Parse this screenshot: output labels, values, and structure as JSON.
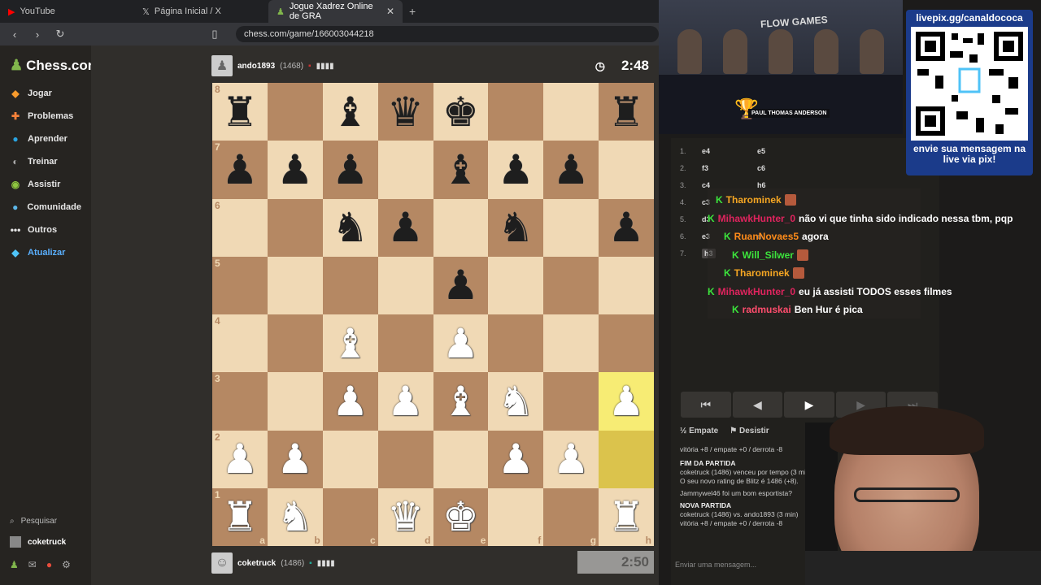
{
  "browser": {
    "tabs": [
      {
        "title": "YouTube",
        "icon": "youtube-icon"
      },
      {
        "title": "Página Inicial / X",
        "icon": "x-icon"
      },
      {
        "title": "Jogue Xadrez Online de GRA",
        "icon": "chess-icon",
        "active": true
      }
    ],
    "url": "chess.com/game/166003044218"
  },
  "sidebar": {
    "logo": "Chess.com",
    "items": [
      {
        "label": "Jogar",
        "icon": "play-icon"
      },
      {
        "label": "Problemas",
        "icon": "puzzle-icon"
      },
      {
        "label": "Aprender",
        "icon": "learn-icon"
      },
      {
        "label": "Treinar",
        "icon": "train-icon"
      },
      {
        "label": "Assistir",
        "icon": "watch-icon"
      },
      {
        "label": "Comunidade",
        "icon": "community-icon"
      },
      {
        "label": "Outros",
        "icon": "more-icon"
      },
      {
        "label": "Atualizar",
        "icon": "diamond-icon"
      }
    ],
    "search_label": "Pesquisar",
    "user": "coketruck"
  },
  "game": {
    "top_player": {
      "name": "ando1893",
      "rating": "(1468)"
    },
    "bottom_player": {
      "name": "coketruck",
      "rating": "(1486)"
    },
    "top_clock": "2:48",
    "bottom_clock": "2:50",
    "ranks": [
      "8",
      "7",
      "6",
      "5",
      "4",
      "3",
      "2",
      "1"
    ],
    "files": [
      "a",
      "b",
      "c",
      "d",
      "e",
      "f",
      "g",
      "h"
    ],
    "board": [
      [
        "r",
        "",
        "b",
        "q",
        "k",
        "",
        "",
        "r"
      ],
      [
        "p",
        "p",
        "p",
        "",
        "b",
        "p",
        "p",
        ""
      ],
      [
        "",
        "",
        "n",
        "p",
        "",
        "n",
        "",
        "p"
      ],
      [
        "",
        "",
        "",
        "",
        "p",
        "",
        "",
        ""
      ],
      [
        "",
        "",
        "B",
        "",
        "P",
        "",
        "",
        ""
      ],
      [
        "",
        "",
        "P",
        "P",
        "B",
        "N",
        "",
        "P"
      ],
      [
        "P",
        "P",
        "",
        "",
        "",
        "P",
        "P",
        ""
      ],
      [
        "R",
        "N",
        "",
        "Q",
        "K",
        "",
        "",
        "R"
      ]
    ],
    "highlight_squares": [
      "h3",
      "h2"
    ]
  },
  "moves": [
    {
      "n": "1.",
      "w": "e4",
      "b": "e5"
    },
    {
      "n": "2.",
      "w": "f3",
      "b": "c6"
    },
    {
      "n": "3.",
      "w": "c4",
      "b": "h6"
    },
    {
      "n": "4.",
      "w": "c3",
      "b": ""
    },
    {
      "n": "5.",
      "w": "d3",
      "b": ""
    },
    {
      "n": "6.",
      "w": "e3",
      "b": "d"
    },
    {
      "n": "7.",
      "w": "h3",
      "b": ""
    }
  ],
  "stream_chat": [
    {
      "user": "Tharominek",
      "color": "#f5a623",
      "msg": ""
    },
    {
      "user": "MihawkHunter_0",
      "color": "#e0245e",
      "msg": "não vi que tinha sido indicado nessa tbm, pqp"
    },
    {
      "user": "RuanNovaes5",
      "color": "#ff8c1a",
      "msg": "agora"
    },
    {
      "user": "Will_Silwer",
      "color": "#3ce43c",
      "msg": ""
    },
    {
      "user": "Tharominek",
      "color": "#f5a623",
      "msg": ""
    },
    {
      "user": "MihawkHunter_0",
      "color": "#e0245e",
      "msg": "eu já assisti TODOS esses filmes"
    },
    {
      "user": "radmuskai",
      "color": "#ff4d6d",
      "msg": "Ben Hur é pica"
    }
  ],
  "controls": {
    "draw": "Empate",
    "resign": "Desistir"
  },
  "log": {
    "line1": "vitória +8 / empate +0 / derrota -8",
    "end_title": "FIM DA PARTIDA",
    "end_text": "coketruck (1486) venceu por tempo (3 min Com l",
    "rating_text": "O seu novo rating de Blitz é 1486 (+8).",
    "msg": "Jammywel46 foi um bom esportista?",
    "new_title": "NOVA PARTIDA",
    "new_text": "coketruck (1486) vs. ando1893 (3 min)",
    "line2": "vitória +8 / empate +0 / derrota -8"
  },
  "chat_placeholder": "Enviar uma mensagem...",
  "overlay": {
    "pix_top": "livepix.gg/canaldococa",
    "pix_bottom": "envie sua mensagem na live via pix!",
    "cam_caption": "PAUL THOMAS ANDERSON",
    "cam_logo": "FLOW GAMES"
  }
}
